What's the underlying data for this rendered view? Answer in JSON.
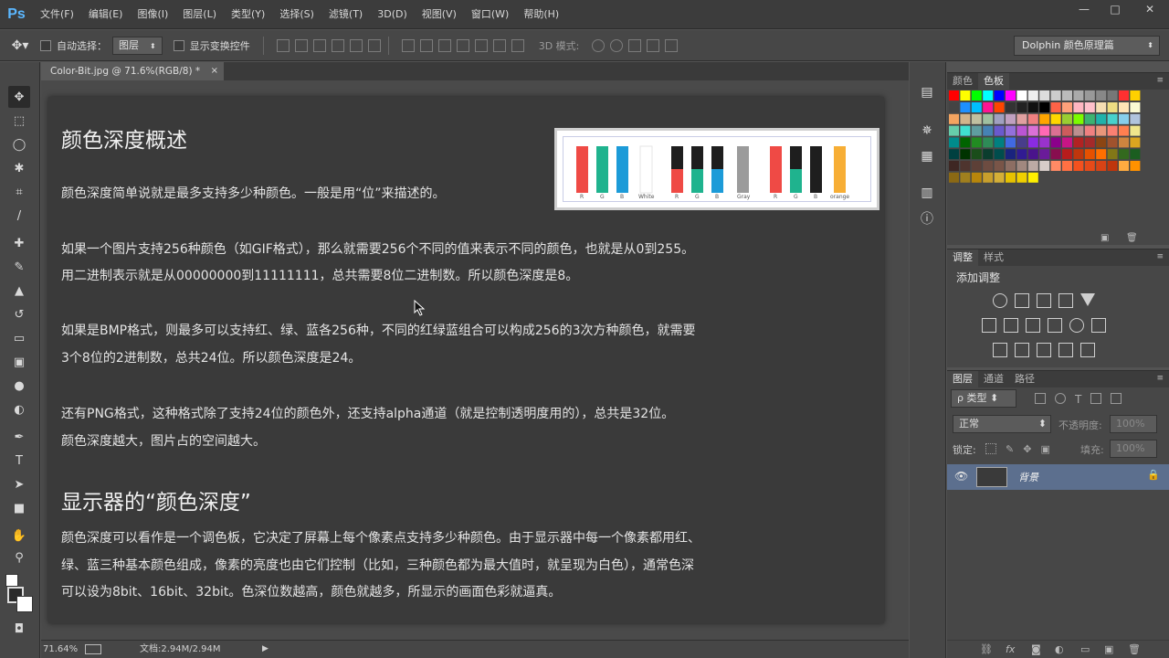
{
  "app": {
    "logo": "Ps"
  },
  "menubar": {
    "items": [
      "文件(F)",
      "编辑(E)",
      "图像(I)",
      "图层(L)",
      "类型(Y)",
      "选择(S)",
      "滤镜(T)",
      "3D(D)",
      "视图(V)",
      "窗口(W)",
      "帮助(H)"
    ]
  },
  "window_controls": {
    "minimize": "—",
    "restore": "□",
    "close": "✕"
  },
  "options": {
    "auto_select_label": "自动选择：",
    "auto_select_value": "图层",
    "show_transform_label": "显示变换控件",
    "mode3d_label": "3D 模式:",
    "workspace": "Dolphin 颜色原理篇"
  },
  "document": {
    "tab_title": "Color-Bit.jpg @ 71.6%(RGB/8) *",
    "heading1": "颜色深度概述",
    "p1": "颜色深度简单说就是最多支持多少种颜色。一般是用“位”来描述的。",
    "p2a": "如果一个图片支持256种颜色（如GIF格式），那么就需要256个不同的值来表示不同的颜色，也就是从0到255。",
    "p2b": "用二进制表示就是从00000000到11111111，总共需要8位二进制数。所以颜色深度是8。",
    "p3a": "如果是BMP格式，则最多可以支持红、绿、蓝各256种，不同的红绿蓝组合可以构成256的3次方种颜色，就需要",
    "p3b": "3个8位的2进制数，总共24位。所以颜色深度是24。",
    "p4a": "还有PNG格式，这种格式除了支持24位的颜色外，还支持alpha通道（就是控制透明度用的），总共是32位。",
    "p4b": "颜色深度越大，图片占的空间越大。",
    "heading2": "显示器的“颜色深度”",
    "p5a": "颜色深度可以看作是一个调色板，它决定了屏幕上每个像素点支持多少种颜色。由于显示器中每一个像素都用红、",
    "p5b": "绿、蓝三种基本颜色组成，像素的亮度也由它们控制（比如，三种颜色都为最大值时，就呈现为白色），通常色深",
    "p5c": "可以设为8bit、16bit、32bit。色深位数越高，颜色就越多，所显示的画面色彩就逼真。",
    "figure_labels": [
      "R",
      "G",
      "B",
      "White",
      "R",
      "G",
      "B",
      "Gray",
      "R",
      "G",
      "B",
      "orange"
    ]
  },
  "status": {
    "zoom": "71.64%",
    "doc_info": "文档:2.94M/2.94M"
  },
  "panels": {
    "color_tabs": [
      "颜色",
      "色板"
    ],
    "adjust_tabs": [
      "调整",
      "样式"
    ],
    "adjust_title": "添加调整",
    "layer_tabs": [
      "图层",
      "通道",
      "路径"
    ],
    "filter_kind": "ρ 类型",
    "blend_mode": "正常",
    "opacity_label": "不透明度:",
    "opacity_value": "100%",
    "lock_label": "锁定:",
    "fill_label": "填充:",
    "fill_value": "100%",
    "layer_name": "背景"
  },
  "colors": {
    "accent": "#5bb7ff",
    "layer_selected": "#5c6f8e"
  }
}
